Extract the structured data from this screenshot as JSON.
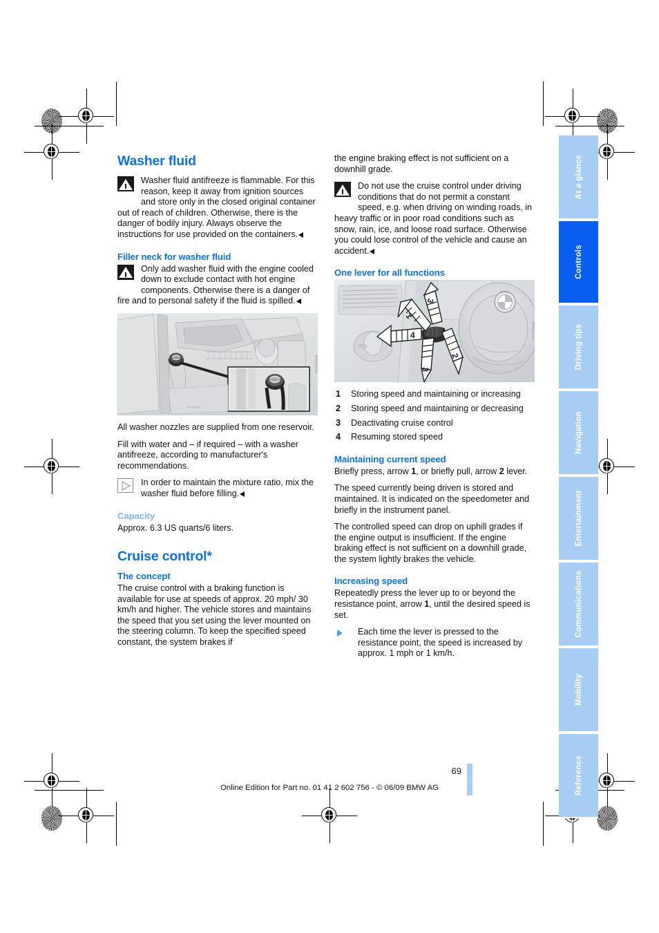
{
  "document": {
    "page_number": "69",
    "footer": "Online Edition for Part no. 01 41 2 602 756 - © 06/09 BMW AG"
  },
  "left_column": {
    "chapter_title": "Washer fluid",
    "warning_1": "Washer fluid antifreeze is flammable. For this reason, keep it away from ignition sources and store only in the closed original container out of reach of children. Otherwise, there is the danger of bodily injury. Always observe the instructions for use provided on the containers.",
    "filler_heading": "Filler neck for washer fluid",
    "warning_2": "Only add washer fluid with the engine cooled down to exclude contact with hot engine components. Otherwise there is a danger of fire and to personal safety if the fluid is spilled.",
    "figure_engine_alt": "Engine bay with washer fluid filler neck and inset detail of cap",
    "para_reservoir": "All washer nozzles are supplied from one reservoir.",
    "para_fill": "Fill with water and – if required – with a washer antifreeze, according to manufacturer's recommendations.",
    "tip_mix": "In order to maintain the mixture ratio, mix the washer fluid before filling.",
    "capacity_heading": "Capacity",
    "capacity_value": "Approx. 6.3 US quarts/6 liters.",
    "cruise_title": "Cruise control*",
    "concept_heading": "The concept",
    "concept_text": "The cruise control with a braking function is available for use at speeds of approx. 20 mph/ 30 km/h and higher. The vehicle stores and maintains the speed that you set using the lever mounted on the steering column. To keep the specified speed constant, the system brakes if"
  },
  "right_column": {
    "continuation_text": "the engine braking effect is not sufficient on a downhill grade.",
    "warning_3": "Do not use the cruise control under driving conditions that do not permit a constant speed, e.g. when driving on winding roads, in heavy traffic or in poor road conditions such as snow, rain, ice, and loose road surface. Otherwise you could lose control of the vehicle and cause an accident.",
    "lever_heading": "One lever for all functions",
    "figure_lever_alt": "Steering column cruise control lever with numbered direction arrows 1, 2, 3, 4",
    "figure_lever_arrows": [
      "1",
      "2",
      "3",
      "3",
      "4"
    ],
    "legend": [
      {
        "num": "1",
        "text": "Storing speed and maintaining or increasing"
      },
      {
        "num": "2",
        "text": "Storing speed and maintaining or decreasing"
      },
      {
        "num": "3",
        "text": "Deactivating cruise control"
      },
      {
        "num": "4",
        "text": "Resuming stored speed"
      }
    ],
    "maintaining_heading": "Maintaining current speed",
    "maintaining_p1_a": "Briefly press, arrow ",
    "maintaining_p1_b": "1",
    "maintaining_p1_c": ", or briefly pull, arrow ",
    "maintaining_p1_d": "2",
    "maintaining_p1_e": " lever.",
    "maintaining_p2": "The speed currently being driven is stored and maintained. It is indicated on the speedometer and briefly in the instrument panel.",
    "maintaining_p3": "The controlled speed can drop on uphill grades if the engine output is insufficient. If the engine braking effect is not sufficient on a downhill grade, the system lightly brakes the vehicle.",
    "increasing_heading": "Increasing speed",
    "increasing_p1_a": "Repeatedly press the lever up to or beyond the resistance point, arrow ",
    "increasing_p1_b": "1",
    "increasing_p1_c": ", until the desired speed is set.",
    "increasing_tip": "Each time the lever is pressed to the resistance point, the speed is increased by approx. 1 mph or 1 km/h."
  },
  "tabs": [
    {
      "label": "At a glance",
      "active": false
    },
    {
      "label": "Controls",
      "active": true
    },
    {
      "label": "Driving tips",
      "active": false
    },
    {
      "label": "Navigation",
      "active": false
    },
    {
      "label": "Entertainment",
      "active": false
    },
    {
      "label": "Communications",
      "active": false
    },
    {
      "label": "Mobility",
      "active": false
    },
    {
      "label": "Reference",
      "active": false
    }
  ],
  "colors": {
    "heading_blue": "#0a72ef",
    "light_blue": "#82b5f2",
    "tab_inactive": "#a8cdf5",
    "tab_active": "#0a5ff0",
    "body_text": "#111111"
  }
}
